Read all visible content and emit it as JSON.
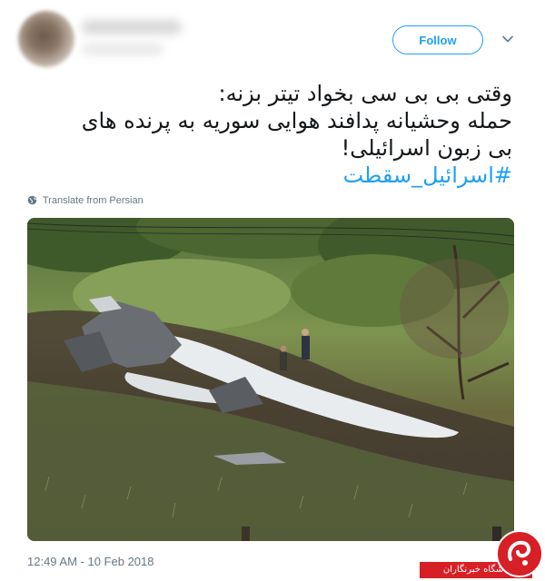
{
  "tweet": {
    "follow_label": "Follow",
    "text_lines": [
      "وقتی بی بی سی بخواد تیتر بزنه:",
      "حمله وحشیانه پدافند هوایی سوریه به پرنده های",
      "بی زبون اسرائیلی!"
    ],
    "hashtag": "#اسرائیل_سقطت",
    "translate_label": "Translate from Persian",
    "timestamp": "12:49 AM - 10 Feb 2018"
  },
  "watermark": {
    "label": "باشگاه خبرنگاران"
  },
  "icons": {
    "caret": "chevron-down-icon",
    "translate": "globe-icon",
    "watermark_logo": "logo-icon"
  },
  "colors": {
    "accent": "#1da1f2",
    "text": "#14171a",
    "muted": "#657786",
    "watermark_red": "#d71f26"
  }
}
